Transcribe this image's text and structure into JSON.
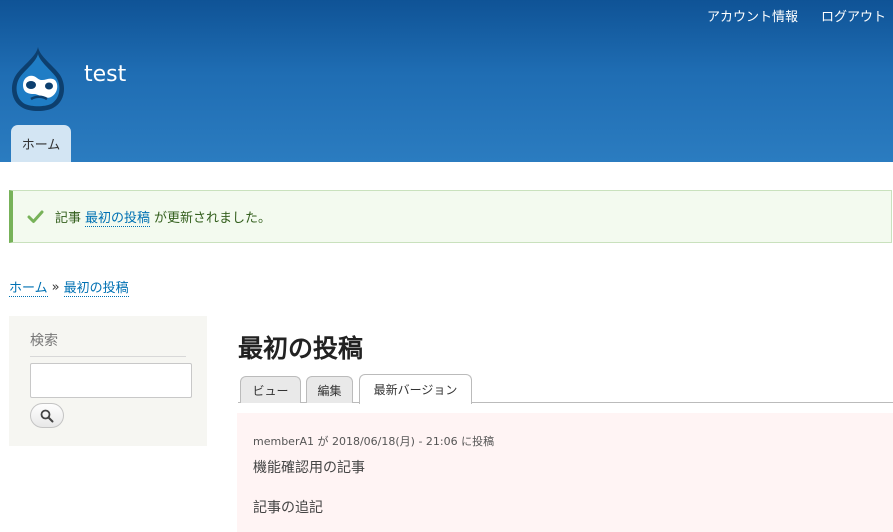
{
  "header": {
    "secondary_menu": [
      "アカウント情報",
      "ログアウト"
    ],
    "site_name": "test",
    "main_tab": "ホーム",
    "colors": {
      "gradient_top": "#0f5396",
      "gradient_bottom": "#2b7cc0"
    },
    "logo_icon": "drupal-drop-logo"
  },
  "status": {
    "icon": "check-icon",
    "prefix": "記事",
    "link": "最初の投稿",
    "suffix": "が更新されました。",
    "accent": "#77b259"
  },
  "breadcrumb": {
    "home": "ホーム",
    "separator": "»",
    "current": "最初の投稿"
  },
  "sidebar": {
    "title": "検索",
    "search_placeholder": "",
    "search_button_icon": "search-icon"
  },
  "main": {
    "title": "最初の投稿",
    "tabs": [
      "ビュー",
      "編集",
      "最新バージョン"
    ],
    "active_tab": "最新バージョン",
    "submitted": "memberA1 が 2018/06/18(月) - 21:06 に投稿",
    "body": [
      "機能確認用の記事",
      "記事の追記"
    ]
  }
}
